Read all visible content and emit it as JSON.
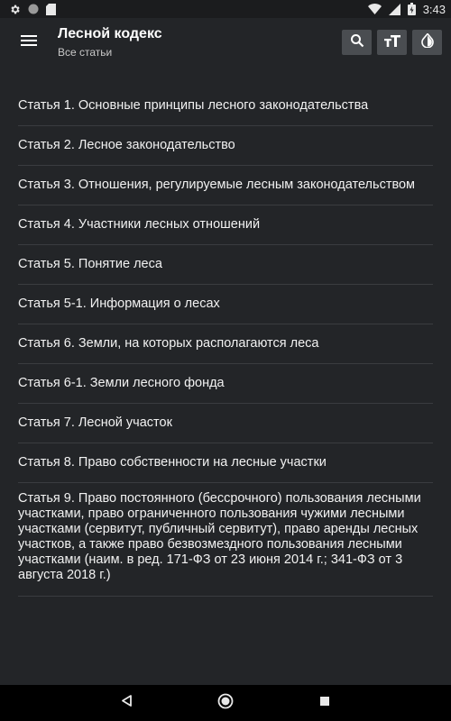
{
  "status_bar": {
    "time": "3:43",
    "icons": [
      "gear-icon",
      "circle-icon",
      "sd-card-icon",
      "wifi-icon",
      "signal-icon",
      "battery-icon"
    ]
  },
  "app_bar": {
    "title": "Лесной кодекс",
    "subtitle": "Все статьи",
    "actions": [
      "search-icon",
      "text-size-icon",
      "theme-drop-icon"
    ]
  },
  "articles": [
    "Статья 1. Основные принципы лесного законодательства",
    "Статья 2. Лесное законодательство",
    "Статья 3. Отношения, регулируемые лесным законодательством",
    "Статья 4. Участники лесных отношений",
    "Статья 5. Понятие леса",
    "Статья 5-1. Информация о лесах",
    "Статья 6. Земли, на которых располагаются леса",
    "Статья 6-1. Земли лесного фонда",
    "Статья 7. Лесной участок",
    "Статья 8. Право собственности на лесные участки",
    "Статья 9. Право постоянного (бессрочного) пользования лесными участками, право ограниченного пользования чужими лесными участками (сервитут, публичный сервитут), право аренды лесных участков, а также право безвозмездного пользования лесными участками (наим. в ред. 171-ФЗ от 23 июня 2014 г.; 341-ФЗ от 3 августа 2018 г.)"
  ],
  "colors": {
    "background": "#232528",
    "status_bar": "#1b1c1e",
    "action_button": "#4a4d51",
    "divider": "#3a3c40",
    "nav_bar": "#000000",
    "text": "#f2f2f2"
  }
}
